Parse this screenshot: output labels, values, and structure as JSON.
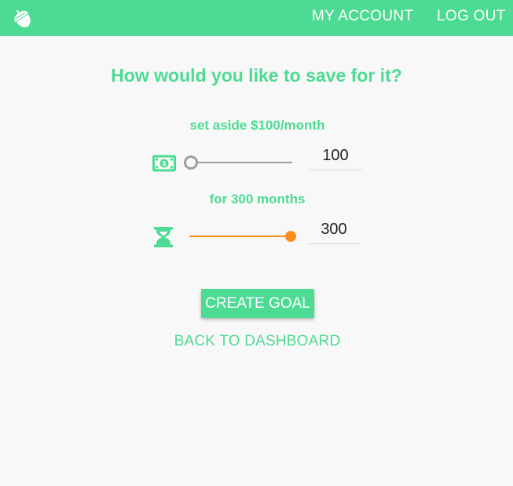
{
  "header": {
    "logo_icon": "acorn-icon",
    "my_account_label": "MY ACCOUNT",
    "logout_label": "LOG OUT",
    "bg_color": "#4ddb93"
  },
  "main": {
    "question": "How would you like to save for it?",
    "amount": {
      "label": "set aside $100/month",
      "icon": "money-icon",
      "value": "100",
      "slider_fraction": 0.0
    },
    "months": {
      "label": "for 300 months",
      "icon": "hourglass-icon",
      "value": "300",
      "slider_fraction": 1.0
    },
    "create_goal_label": "CREATE GOAL",
    "back_label": "BACK TO DASHBOARD"
  },
  "colors": {
    "accent": "#4ddb93",
    "slider_active": "#ff8c1a",
    "slider_inactive": "#9e9e9e",
    "background": "#f8f8f8"
  }
}
